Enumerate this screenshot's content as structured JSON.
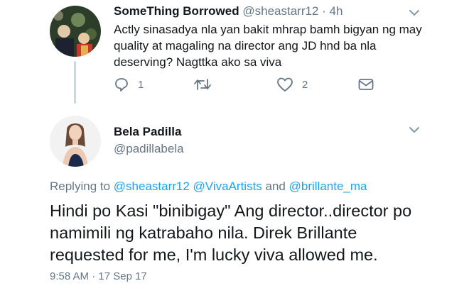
{
  "reply_tweet": {
    "author_name": "SomeThing Borrowed",
    "author_handle": "@sheastarr12",
    "separator": " · ",
    "time": "4h",
    "text": "Actly sinasadya nla yan bakit mhrap bamh bigyan ng may quality at magaling na director ang JD hnd ba nla deserving? Nagttka ako sa viva",
    "actions": {
      "reply_count": "1",
      "retweet_count": "",
      "like_count": "2"
    }
  },
  "main_tweet": {
    "author_name": "Bela Padilla",
    "author_handle": "@padillabela",
    "replying_to": {
      "prefix": "Replying to ",
      "mention_1": "@sheastarr12",
      "mention_2": "@VivaArtists",
      "conjunction": " and ",
      "mention_3": "@brillante_ma"
    },
    "text": "Hindi po Kasi \"binibigay\" Ang director..director po namimili ng katrabaho nila. Direk Brillante requested for me, I'm lucky viva allowed me.",
    "timestamp": "9:58 AM · 17 Sep 17"
  },
  "colors": {
    "accent": "#1da1f2",
    "muted": "#657786",
    "text": "#14171a",
    "thread_line": "#ccd6dd"
  },
  "icons": [
    "reply-icon",
    "retweet-icon",
    "like-icon",
    "direct-message-icon",
    "chevron-down-icon"
  ]
}
